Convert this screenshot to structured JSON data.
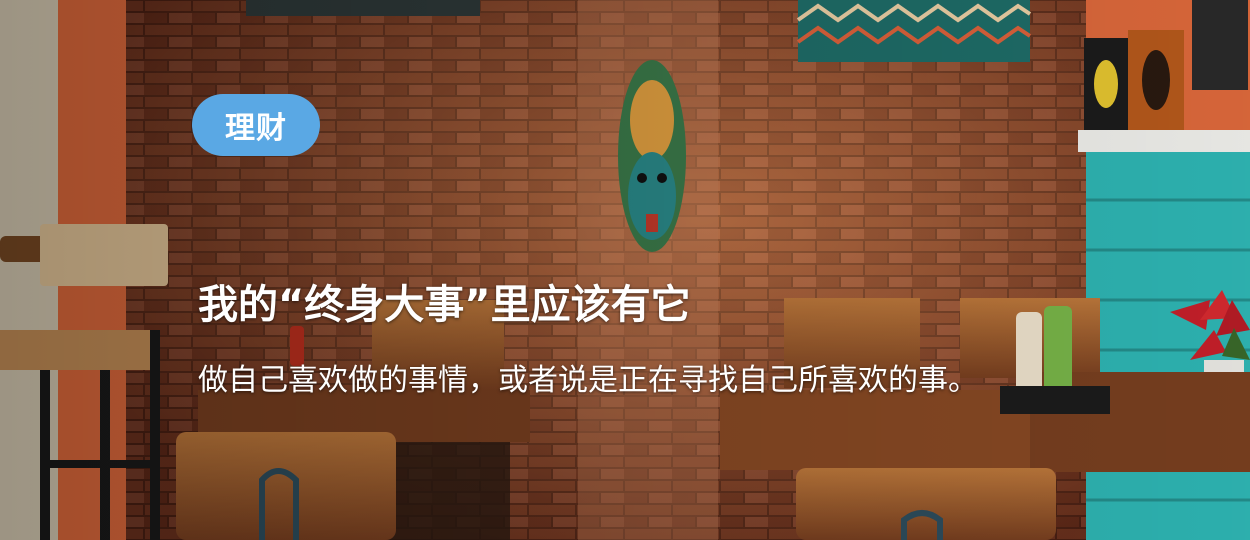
{
  "banner": {
    "tag_label": "理财",
    "title": "我的“终身大事”里应该有它",
    "subtitle": "做自己喜欢做的事情，或者说是正在寻找自己所喜欢的事。"
  },
  "colors": {
    "tag_background": "#5aa8e4",
    "text": "#ffffff",
    "brick_wall": "#8a3f28",
    "orange_wall": "#e06a3c",
    "teal_wall": "#2fb8b6",
    "wood": "#9a5a2a"
  },
  "image": {
    "subject": "cafe-interior-photo"
  }
}
